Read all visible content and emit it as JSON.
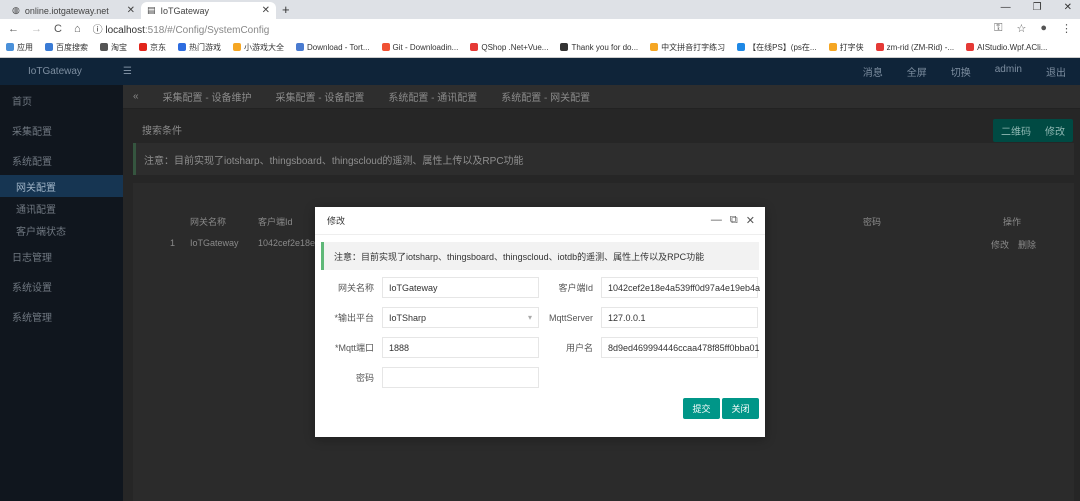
{
  "browser": {
    "tabs": [
      {
        "title": "online.iotgateway.net"
      },
      {
        "title": "IoTGateway"
      }
    ],
    "url_host": "localhost",
    "url_rest": ":518/#/Config/SystemConfig",
    "bookmarks": [
      "应用",
      "百度搜索",
      "淘宝",
      "京东",
      "热门游戏",
      "小游戏大全",
      "Download - Tort...",
      "Git - Downloadin...",
      "QShop .Net+Vue...",
      "Thank you for do...",
      "中文拼音打字练习",
      "【在线PS】(ps在...",
      "打字侠",
      "zm-rid (ZM-Rid) -...",
      "AIStudio.Wpf.ACli..."
    ],
    "bookmark_colors": [
      "#4a90d9",
      "#3a7bd5",
      "#555",
      "#e1251b",
      "#2d6cdf",
      "#f5a623",
      "#4a7bd0",
      "#f05133",
      "#e53935",
      "#333",
      "#f5a623",
      "#1e88e5",
      "#f5a623",
      "#e53935",
      "#e53935"
    ]
  },
  "app": {
    "logo": "IoTGateway",
    "header_right": [
      "消息",
      "全屏",
      "切换",
      "admin",
      "退出"
    ],
    "sidebar": [
      {
        "label": "首页"
      },
      {
        "label": "采集配置"
      },
      {
        "label": "系统配置"
      },
      {
        "label": "网关配置"
      },
      {
        "label": "通讯配置"
      },
      {
        "label": "客户端状态"
      },
      {
        "label": "日志管理"
      },
      {
        "label": "系统设置"
      },
      {
        "label": "系统管理"
      }
    ],
    "tabs": [
      "采集配置 - 设备维护",
      "采集配置 - 设备配置",
      "系统配置 - 通讯配置",
      "系统配置 - 网关配置"
    ],
    "panel_title": "搜索条件",
    "btn_qr": "二维码",
    "btn_edit": "修改",
    "alert": "注意：目前实现了iotsharp、thingsboard、thingscloud的遥测、属性上传以及RPC功能",
    "table": {
      "headers": [
        "网关名称",
        "客户端Id",
        "密码",
        "操作"
      ],
      "row": [
        "1",
        "IoTGateway",
        "1042cef2e18e4a539ff0d97a4e19eb4a",
        [
          "修改",
          "删除"
        ]
      ]
    }
  },
  "modal": {
    "title": "修改",
    "notice": "注意：目前实现了iotsharp、thingsboard、thingscloud、iotdb的遥测、属性上传以及RPC功能",
    "fields": {
      "gateway_name": {
        "label": "网关名称",
        "value": "IoTGateway"
      },
      "client_id": {
        "label": "客户端Id",
        "value": "1042cef2e18e4a539ff0d97a4e19eb4a"
      },
      "platform": {
        "label": "*输出平台",
        "value": "IoTSharp"
      },
      "mqtt_server": {
        "label": "MqttServer",
        "value": "127.0.0.1"
      },
      "mqtt_port": {
        "label": "*Mqtt端口",
        "value": "1888"
      },
      "username": {
        "label": "用户名",
        "value": "8d9ed469994446ccaa478f85ff0bba01"
      },
      "password": {
        "label": "密码",
        "value": ""
      }
    },
    "submit": "提交",
    "close": "关闭"
  }
}
